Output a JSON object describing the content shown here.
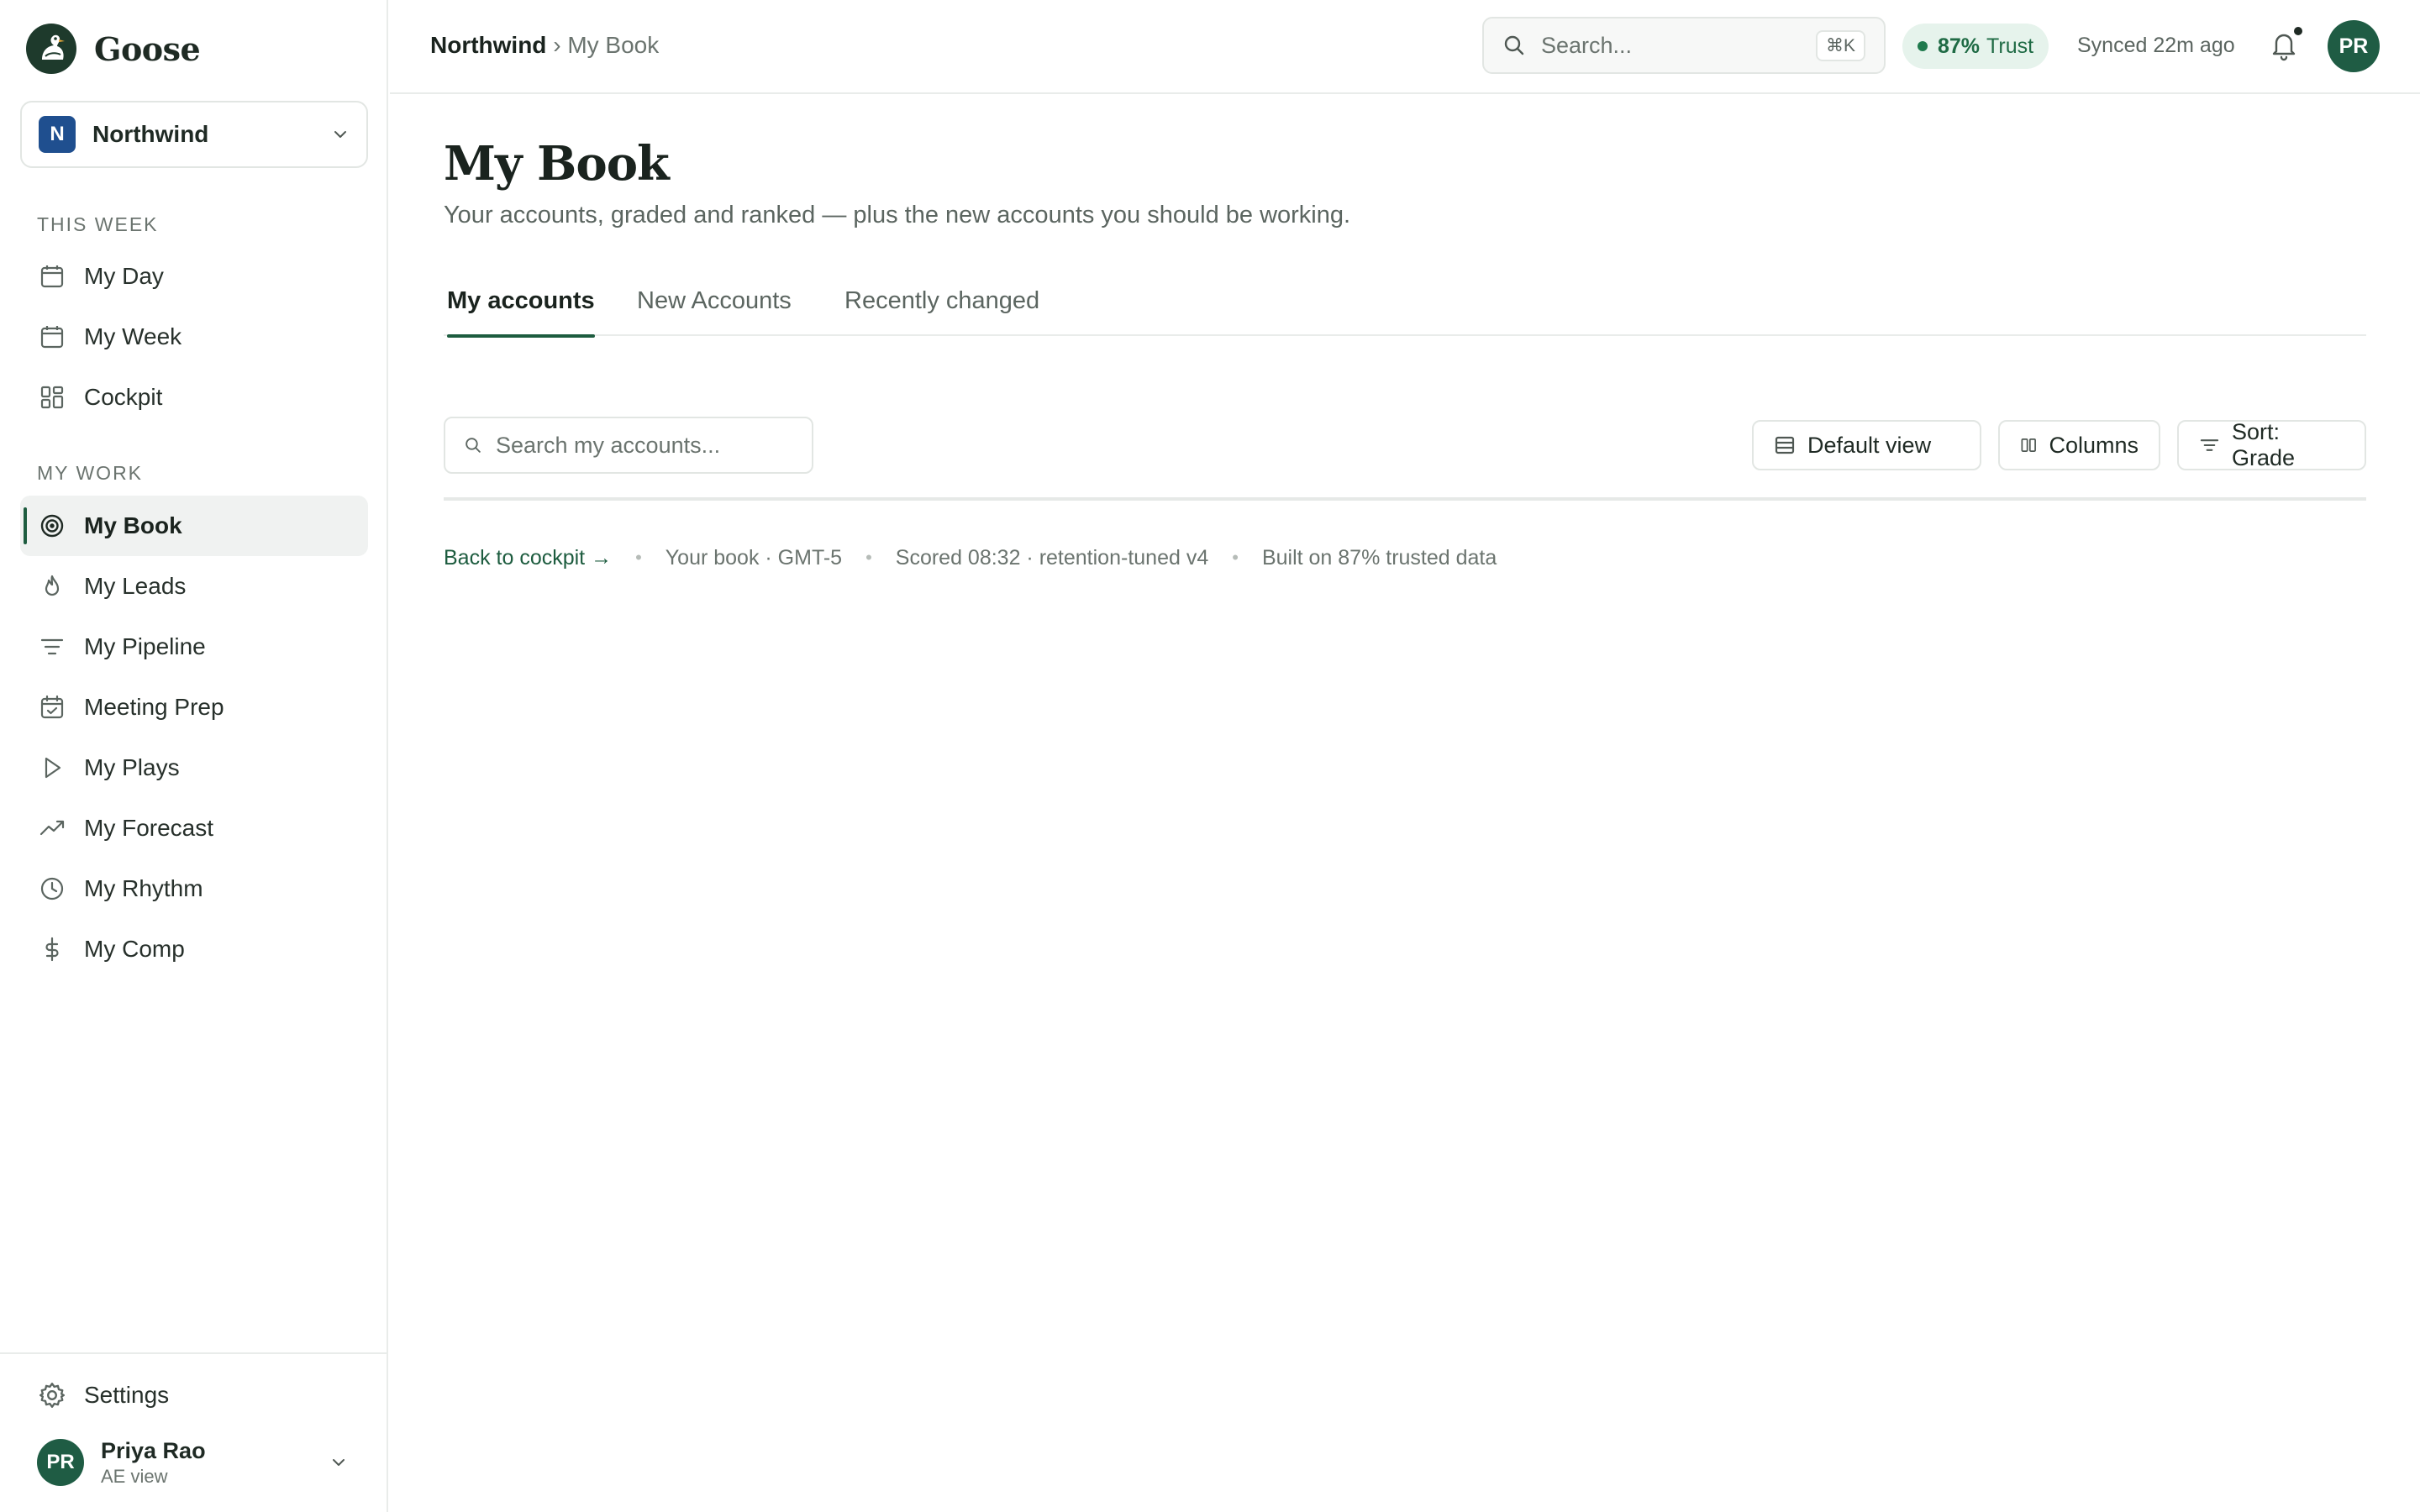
{
  "brand": {
    "name": "Goose"
  },
  "workspace": {
    "initial": "N",
    "name": "Northwind"
  },
  "sidebar": {
    "sections": [
      {
        "label": "THIS WEEK",
        "items": [
          {
            "label": "My Day",
            "icon": "calendar-icon"
          },
          {
            "label": "My Week",
            "icon": "calendar-icon"
          },
          {
            "label": "Cockpit",
            "icon": "grid-icon"
          }
        ]
      },
      {
        "label": "MY WORK",
        "items": [
          {
            "label": "My Book",
            "icon": "target-icon",
            "active": true
          },
          {
            "label": "My Leads",
            "icon": "flame-icon"
          },
          {
            "label": "My Pipeline",
            "icon": "filter-icon"
          },
          {
            "label": "Meeting Prep",
            "icon": "calendar-check-icon"
          },
          {
            "label": "My Plays",
            "icon": "play-icon"
          },
          {
            "label": "My Forecast",
            "icon": "trend-icon"
          },
          {
            "label": "My Rhythm",
            "icon": "clock-icon"
          },
          {
            "label": "My Comp",
            "icon": "dollar-icon"
          }
        ]
      }
    ],
    "settings_label": "Settings",
    "user": {
      "initials": "PR",
      "name": "Priya Rao",
      "role": "AE view"
    }
  },
  "topbar": {
    "breadcrumb_root": "Northwind",
    "breadcrumb_sep": "›",
    "breadcrumb_current": "My Book",
    "search_placeholder": "Search...",
    "search_shortcut": "⌘K",
    "trust_value": "87%",
    "trust_label": "Trust",
    "synced": "Synced 22m ago",
    "avatar_initials": "PR"
  },
  "main": {
    "title": "My Book",
    "subtitle": "Your accounts, graded and ranked — plus the new accounts you should be working.",
    "tabs": [
      {
        "label": "My accounts",
        "active": true
      },
      {
        "label": "New Accounts",
        "active": false
      },
      {
        "label": "Recently changed",
        "active": false
      }
    ],
    "search_placeholder": "Search my accounts...",
    "toolbar": {
      "view_label": "Default view",
      "columns_label": "Columns",
      "sort_label": "Sort: Grade"
    },
    "meta": {
      "back_link": "Back to cockpit →",
      "book": "Your book · GMT-5",
      "scored": "Scored 08:32 · retention-tuned v4",
      "built": "Built on 87% trusted data"
    }
  },
  "colors": {
    "accent": "#1d5c3f",
    "workspace_badge": "#1f4f8f",
    "trust_bg": "#e6f3ec",
    "trust_text": "#1f6b45"
  }
}
